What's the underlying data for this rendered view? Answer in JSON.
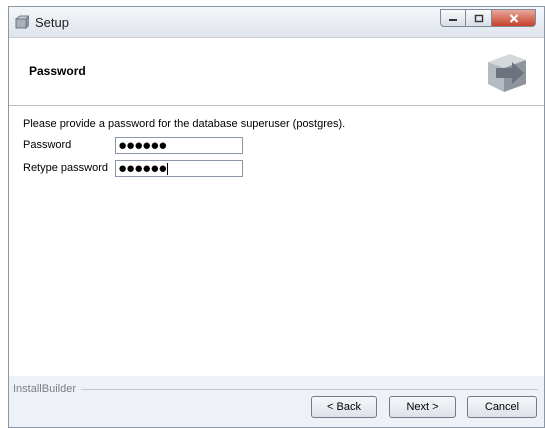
{
  "window": {
    "title": "Setup",
    "controls": [
      "minimize-icon",
      "maximize-icon",
      "close-icon"
    ]
  },
  "header": {
    "title": "Password",
    "logo_icon": "installbuilder-box-icon"
  },
  "form": {
    "intro": "Please provide a password for the database superuser (postgres).",
    "password_label": "Password",
    "password_value": "●●●●●●",
    "retype_label": "Retype password",
    "retype_value": "●●●●●●"
  },
  "footer": {
    "brand": "InstallBuilder",
    "back_label": "< Back",
    "next_label": "Next >",
    "cancel_label": "Cancel"
  },
  "colors": {
    "window_bg": "#eef1f5",
    "panel_bg": "#ffffff",
    "close_button": "#c7402a"
  }
}
